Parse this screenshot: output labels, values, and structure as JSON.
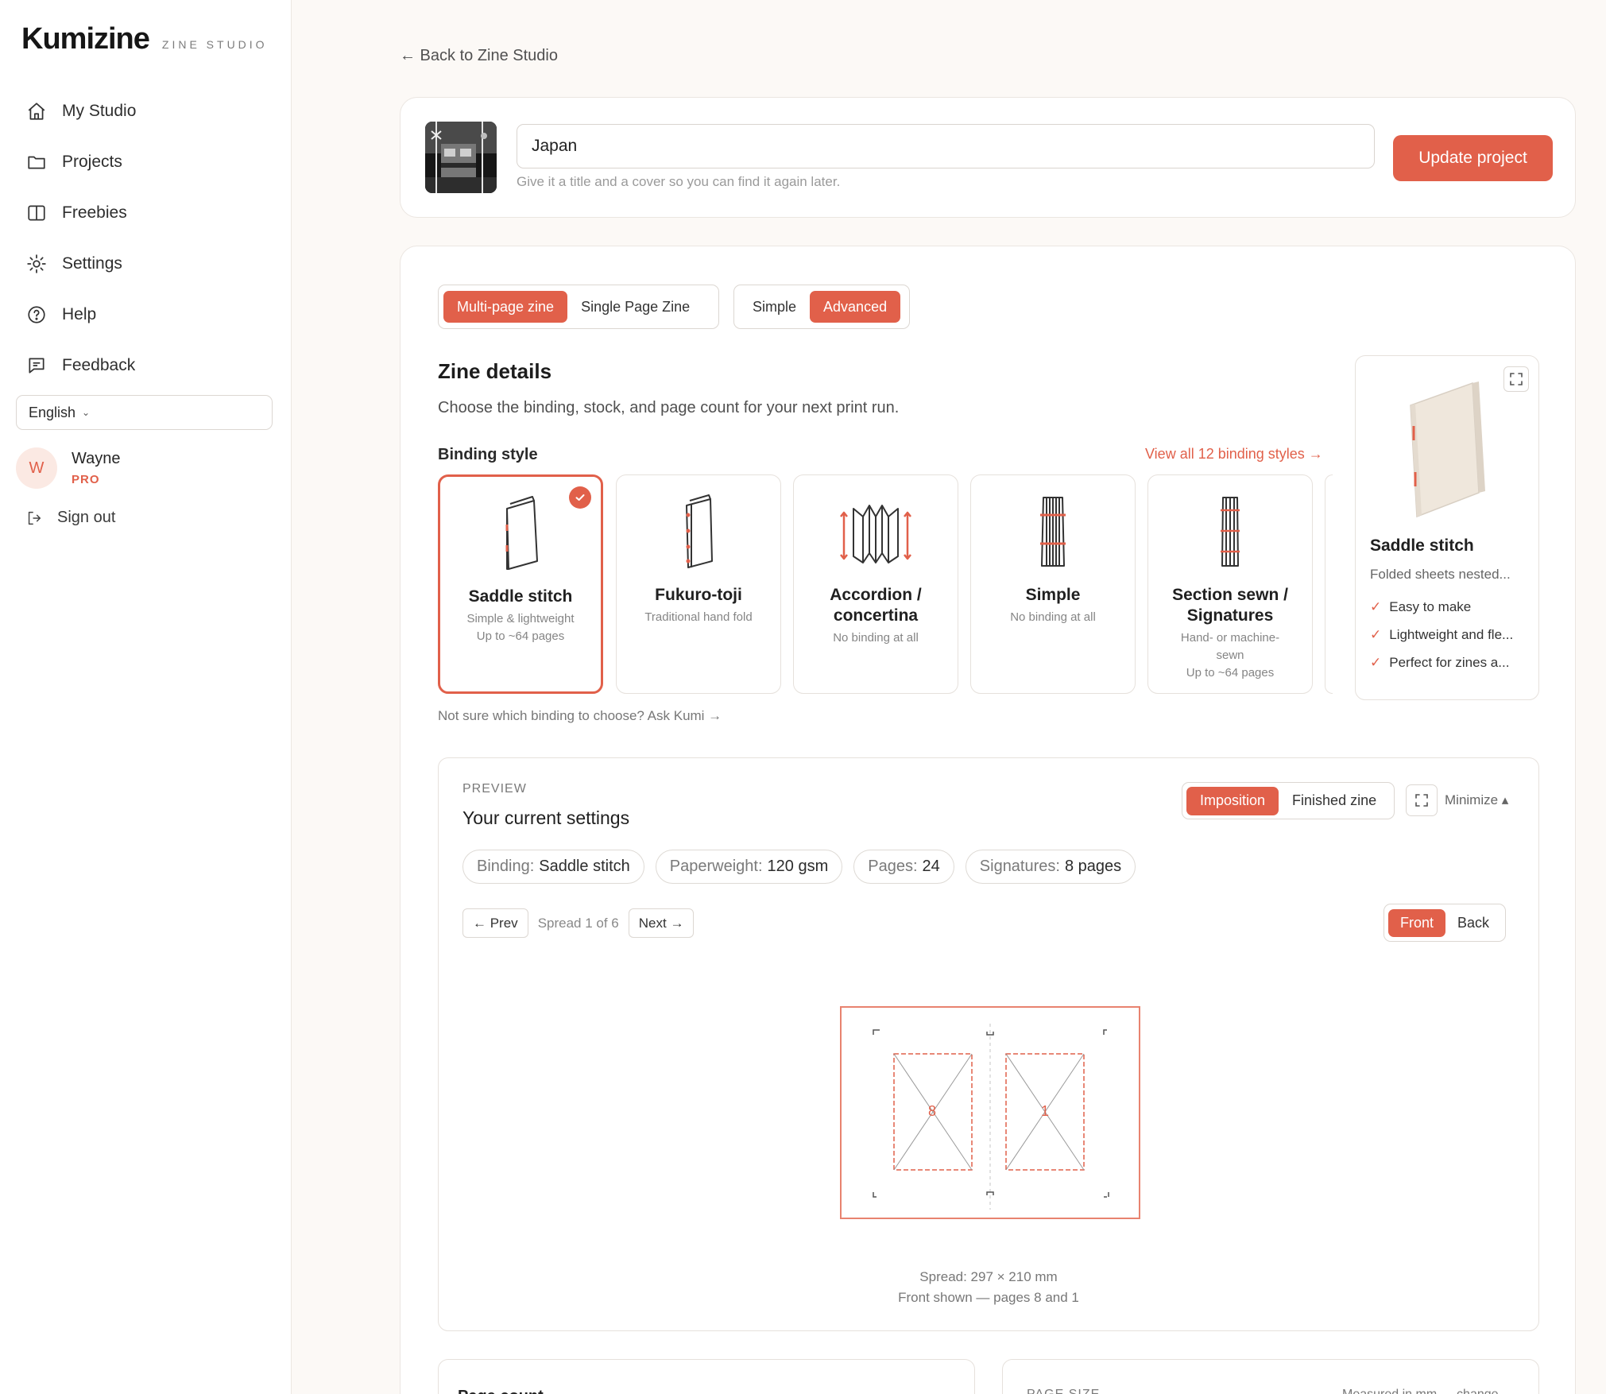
{
  "brand": {
    "logo": "Kumizine",
    "sub": "ZINE STUDIO"
  },
  "nav": [
    {
      "label": "My Studio",
      "icon": "home-icon"
    },
    {
      "label": "Projects",
      "icon": "folder-icon"
    },
    {
      "label": "Freebies",
      "icon": "book-icon"
    },
    {
      "label": "Settings",
      "icon": "sun-gear-icon"
    },
    {
      "label": "Help",
      "icon": "help-circle-icon"
    },
    {
      "label": "Feedback",
      "icon": "message-icon"
    }
  ],
  "language": {
    "value": "English"
  },
  "user": {
    "initial": "W",
    "name": "Wayne",
    "badge": "PRO"
  },
  "signout": {
    "label": "Sign out"
  },
  "back": {
    "label": "← Back to Zine Studio"
  },
  "project": {
    "title_value": "Japan",
    "hint": "Give it a title and a cover so you can find it again later.",
    "update_label": "Update project"
  },
  "mode": {
    "multi": "Multi-page zine",
    "single": "Single Page Zine",
    "active": "multi"
  },
  "level": {
    "simple": "Simple",
    "advanced": "Advanced",
    "active": "advanced"
  },
  "details": {
    "title": "Zine details",
    "subtitle": "Choose the binding, stock, and page count for your next print run.",
    "binding_label": "Binding style",
    "view_all": "View all 12 binding styles →",
    "ask": "Not sure which binding to choose? Ask Kumi →"
  },
  "bindings": [
    {
      "name": "Saddle stitch",
      "desc1": "Simple & lightweight",
      "desc2": "Up to ~64 pages",
      "desc3": ""
    },
    {
      "name": "Fukuro-toji",
      "desc1": "Traditional hand fold",
      "desc2": "",
      "desc3": ""
    },
    {
      "name": "Accordion / concertina",
      "desc1": "No binding at all",
      "desc2": "",
      "desc3": ""
    },
    {
      "name": "Simple",
      "desc1": "No binding at all",
      "desc2": "",
      "desc3": ""
    },
    {
      "name": "Section sewn / Signatures",
      "desc1": "Hand- or machine-",
      "desc2": "sewn",
      "desc3": "Up to ~64 pages"
    }
  ],
  "selected_binding": {
    "title": "Saddle stitch",
    "desc": "Folded sheets nested...",
    "features": [
      "Easy to make",
      "Lightweight and fle...",
      "Perfect for zines a..."
    ]
  },
  "preview": {
    "kicker": "PREVIEW",
    "title": "Your current settings",
    "view_tabs": {
      "imposition": "Imposition",
      "finished": "Finished zine",
      "active": "imposition"
    },
    "minimize": "Minimize ▴",
    "chips": [
      {
        "k": "Binding:",
        "v": "Saddle stitch"
      },
      {
        "k": "Paperweight:",
        "v": "120 gsm"
      },
      {
        "k": "Pages:",
        "v": "24"
      },
      {
        "k": "Signatures:",
        "v": "8 pages"
      }
    ],
    "prev": "← Prev",
    "spread_label": "Spread 1 of 6",
    "next": "Next →",
    "side": {
      "front": "Front",
      "back": "Back",
      "active": "front"
    },
    "left_page": "8",
    "right_page": "1",
    "meta1": "Spread: 297 × 210 mm",
    "meta2": "Front shown — pages 8 and 1"
  },
  "page_count": {
    "label": "Page count"
  },
  "page_size": {
    "label": "PAGE SIZE",
    "note": "Measured in mm — change →"
  },
  "colors": {
    "accent": "#e1604a"
  }
}
